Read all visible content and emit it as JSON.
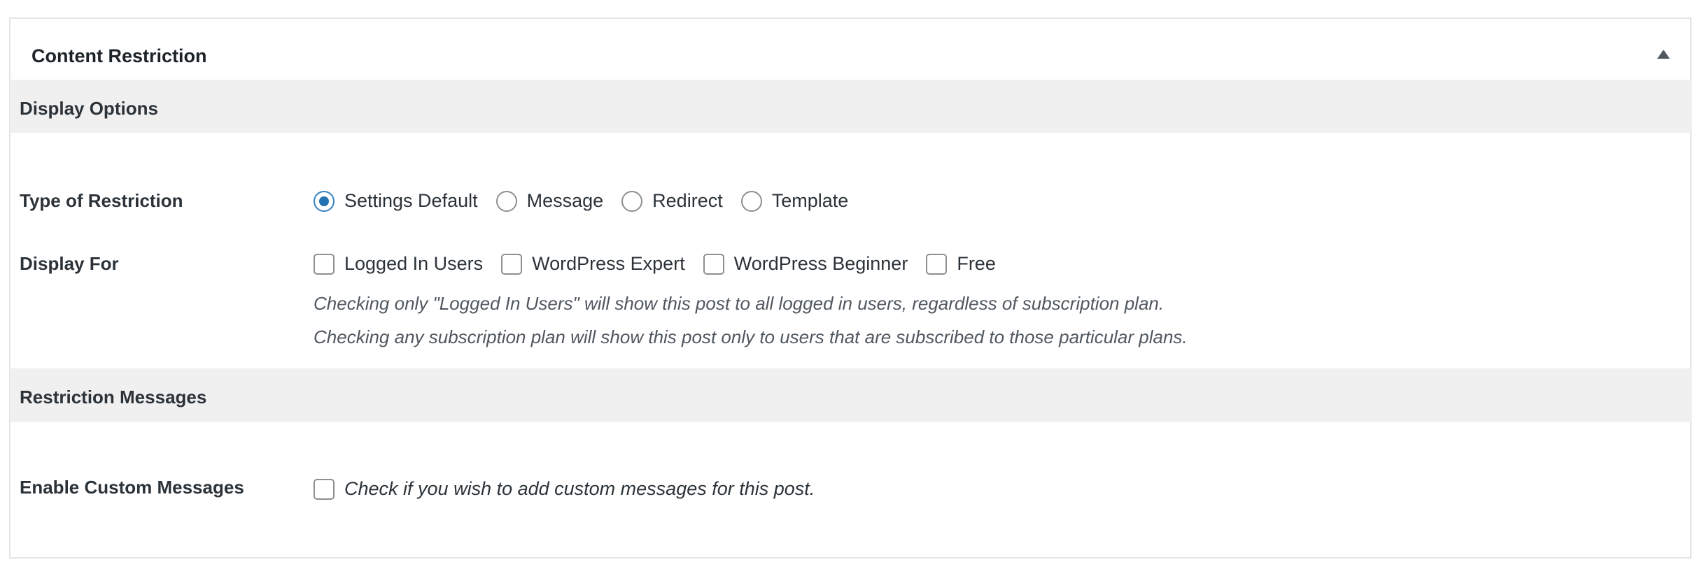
{
  "metabox": {
    "title": "Content Restriction",
    "toggle_icon": "triangle-up-icon"
  },
  "display_options": {
    "section_title": "Display Options",
    "type_of_restriction": {
      "label": "Type of Restriction",
      "options": [
        {
          "label": "Settings Default",
          "checked": true
        },
        {
          "label": "Message",
          "checked": false
        },
        {
          "label": "Redirect",
          "checked": false
        },
        {
          "label": "Template",
          "checked": false
        }
      ]
    },
    "display_for": {
      "label": "Display For",
      "options": [
        {
          "label": "Logged In Users",
          "checked": false
        },
        {
          "label": "WordPress Expert",
          "checked": false
        },
        {
          "label": "WordPress Beginner",
          "checked": false
        },
        {
          "label": "Free",
          "checked": false
        }
      ],
      "description_1": "Checking only \"Logged In Users\" will show this post to all logged in users, regardless of subscription plan.",
      "description_2": "Checking any subscription plan will show this post only to users that are subscribed to those particular plans."
    }
  },
  "restriction_messages": {
    "section_title": "Restriction Messages",
    "enable_custom_messages": {
      "label": "Enable Custom Messages",
      "checkbox_label": "Check if you wish to add custom messages for this post.",
      "checked": false
    }
  },
  "colors": {
    "accent": "#2271b1",
    "band_background": "#f0f0f1",
    "border": "#e2e4e7"
  }
}
